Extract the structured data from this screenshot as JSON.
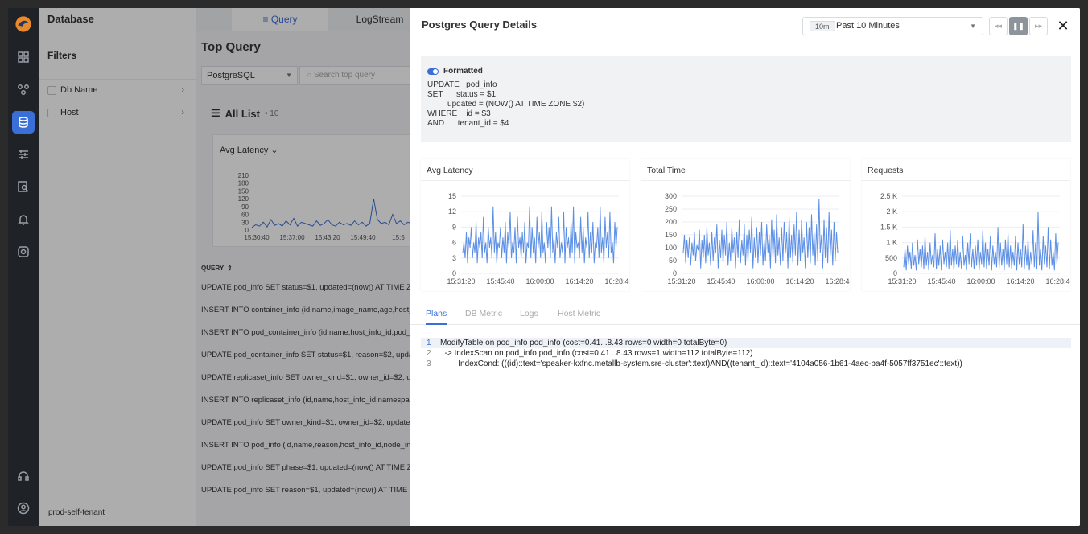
{
  "sidebar": {
    "icons": [
      "logo-icon",
      "dashboard-icon",
      "topology-icon",
      "database-icon",
      "sliders-icon",
      "search-doc-icon",
      "bell-icon",
      "settings-icon",
      "headset-icon",
      "user-icon"
    ]
  },
  "filters": {
    "app_title": "Database",
    "title": "Filters",
    "items": [
      {
        "label": "Db Name"
      },
      {
        "label": "Host"
      }
    ],
    "tenant": "prod-self-tenant"
  },
  "main": {
    "tabs": {
      "query": "Query",
      "logstream": "LogStream"
    },
    "title": "Top Query",
    "db_select": "PostgreSQL",
    "search_placeholder": "Search top query",
    "all_list": "All List",
    "count": "10",
    "metric_select": "Avg Latency",
    "query_header": "QUERY",
    "mini_chart": {
      "yticks": [
        "210",
        "180",
        "150",
        "120",
        "90",
        "60",
        "30",
        "0"
      ],
      "xticks": [
        "15:30:40",
        "15:37:00",
        "15:43:20",
        "15:49:40",
        "15:5"
      ]
    },
    "queries": [
      "UPDATE pod_info SET status=$1, updated=(now() AT TIME Z",
      "INSERT INTO container_info (id,name,image_name,age,host_",
      "INSERT INTO pod_container_info (id,name,host_info_id,pod_",
      "UPDATE pod_container_info SET status=$1, reason=$2, upda",
      "UPDATE replicaset_info SET owner_kind=$1, owner_id=$2, u",
      "INSERT INTO replicaset_info (id,name,host_info_id,namespa",
      "UPDATE pod_info SET owner_kind=$1, owner_id=$2, updated",
      "INSERT INTO pod_info (id,name,reason,host_info_id,node_in",
      "UPDATE pod_info SET phase=$1, updated=(now() AT TIME Z",
      "UPDATE pod_info SET reason=$1, updated=(now() AT TIME"
    ]
  },
  "panel": {
    "title": "Postgres Query Details",
    "time_badge": "10m",
    "time_label": "Past 10 Minutes",
    "controls": {
      "rewind": "◂◂",
      "pause": "❚❚",
      "forward": "▸▸",
      "close": "✕"
    },
    "formatted_label": "Formatted",
    "sql": "UPDATE   pod_info\nSET      status = $1,\n         updated = (NOW() AT TIME ZONE $2)\nWHERE    id = $3\nAND      tenant_id = $4",
    "tabs": [
      "Plans",
      "DB Metric",
      "Logs",
      "Host Metric"
    ],
    "plans": [
      {
        "n": "1",
        "text": "ModifyTable on pod_info pod_info (cost=0.41...8.43 rows=0 width=0 totalByte=0)"
      },
      {
        "n": "2",
        "text": "  -> IndexScan on pod_info pod_info (cost=0.41...8.43 rows=1 width=112 totalByte=112)"
      },
      {
        "n": "3",
        "text": "        IndexCond: (((id)::text='speaker-kxfnc.metallb-system.sre-cluster'::text)AND((tenant_id)::text='4104a056-1b61-4aec-ba4f-5057ff3751ec'::text))"
      }
    ]
  },
  "chart_data": [
    {
      "type": "line",
      "title": "Avg Latency",
      "ylim": [
        0,
        15
      ],
      "yticks": [
        "15",
        "12",
        "9",
        "6",
        "3",
        "0"
      ],
      "xticks": [
        "15:31:20",
        "15:45:40",
        "16:00:00",
        "16:14:20",
        "16:28:40"
      ],
      "color": "#5b8fe6",
      "values": [
        4,
        6,
        3,
        8,
        2,
        7,
        5,
        9,
        3,
        6,
        4,
        10,
        2,
        7,
        5,
        8,
        3,
        11,
        4,
        6,
        2,
        9,
        5,
        7,
        3,
        13,
        4,
        8,
        2,
        6,
        5,
        9,
        3,
        7,
        4,
        10,
        2,
        8,
        5,
        12,
        3,
        6,
        4,
        9,
        2,
        11,
        5,
        7,
        3,
        8,
        4,
        10,
        2,
        6,
        5,
        13,
        3,
        9,
        4,
        7,
        2,
        11,
        5,
        8,
        3,
        12,
        4,
        6,
        2,
        10,
        5,
        9,
        3,
        13,
        4,
        7,
        2,
        8,
        5,
        11,
        3,
        6,
        4,
        12,
        2,
        9,
        5,
        7,
        3,
        10,
        4,
        13,
        2,
        8,
        5,
        6,
        3,
        11,
        4,
        9,
        2,
        7,
        5,
        12,
        3,
        8,
        4,
        10,
        2,
        6,
        5,
        9,
        3,
        13,
        4,
        7,
        2,
        11,
        5,
        8,
        3,
        12,
        4,
        6,
        2,
        10,
        5,
        9
      ]
    },
    {
      "type": "line",
      "title": "Total Time",
      "ylim": [
        0,
        300
      ],
      "yticks": [
        "300",
        "250",
        "200",
        "150",
        "100",
        "50",
        "0"
      ],
      "xticks": [
        "15:31:20",
        "15:45:40",
        "16:00:00",
        "16:14:20",
        "16:28:40"
      ],
      "color": "#5b8fe6",
      "values": [
        80,
        150,
        40,
        130,
        60,
        140,
        30,
        120,
        70,
        160,
        50,
        110,
        90,
        170,
        20,
        130,
        60,
        150,
        40,
        180,
        70,
        120,
        30,
        160,
        50,
        140,
        80,
        190,
        20,
        130,
        60,
        170,
        40,
        150,
        70,
        200,
        30,
        120,
        50,
        180,
        80,
        140,
        20,
        160,
        60,
        210,
        40,
        130,
        70,
        190,
        30,
        150,
        50,
        170,
        80,
        220,
        20,
        140,
        60,
        180,
        40,
        160,
        70,
        200,
        30,
        130,
        50,
        190,
        80,
        150,
        20,
        210,
        60,
        170,
        40,
        230,
        70,
        140,
        30,
        180,
        50,
        200,
        80,
        160,
        20,
        220,
        60,
        150,
        40,
        190,
        70,
        240,
        30,
        170,
        50,
        210,
        80,
        140,
        20,
        200,
        60,
        180,
        40,
        230,
        70,
        160,
        30,
        190,
        50,
        290,
        80,
        150,
        20,
        210,
        60,
        180,
        40,
        240,
        70,
        170,
        30,
        200,
        50,
        160,
        80
      ]
    },
    {
      "type": "line",
      "title": "Requests",
      "ylim": [
        0,
        2500
      ],
      "yticks": [
        "2.5 K",
        "2 K",
        "1.5 K",
        "1 K",
        "500",
        "0"
      ],
      "xticks": [
        "15:31:20",
        "15:45:40",
        "16:00:00",
        "16:14:20",
        "16:28:40"
      ],
      "color": "#5b8fe6",
      "values": [
        200,
        800,
        100,
        900,
        300,
        700,
        150,
        1000,
        250,
        600,
        100,
        1100,
        300,
        800,
        200,
        900,
        150,
        1200,
        250,
        700,
        100,
        1000,
        300,
        600,
        200,
        1300,
        150,
        800,
        250,
        900,
        100,
        1100,
        300,
        700,
        200,
        1000,
        150,
        1400,
        250,
        800,
        100,
        900,
        300,
        1100,
        200,
        700,
        150,
        1200,
        250,
        600,
        100,
        1000,
        300,
        1300,
        200,
        800,
        150,
        900,
        250,
        1100,
        100,
        700,
        300,
        1400,
        200,
        1000,
        150,
        800,
        250,
        1200,
        100,
        900,
        300,
        700,
        200,
        1500,
        150,
        1000,
        250,
        800,
        100,
        1100,
        300,
        1300,
        200,
        900,
        150,
        700,
        250,
        1200,
        100,
        1000,
        300,
        800,
        200,
        1600,
        150,
        900,
        250,
        1100,
        100,
        700,
        300,
        1400,
        200,
        1000,
        150,
        2000,
        250,
        800,
        100,
        1200,
        300,
        900,
        200,
        1500,
        150,
        1100,
        250,
        700,
        100,
        1300,
        300,
        1000
      ]
    }
  ]
}
